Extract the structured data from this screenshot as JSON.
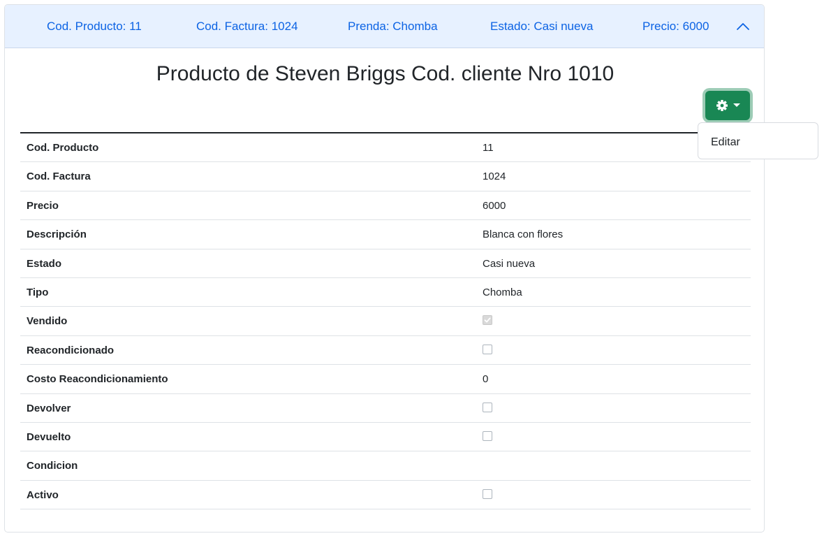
{
  "header": {
    "cod_producto": "Cod. Producto: 11",
    "cod_factura": "Cod. Factura: 1024",
    "prenda": "Prenda: Chomba",
    "estado": "Estado: Casi nueva",
    "precio": "Precio: 6000",
    "toggle_icon": "chevron-up-icon"
  },
  "title": "Producto de Steven Briggs Cod. cliente Nro 1010",
  "actions": {
    "button_icon": "gear-icon",
    "button_color": "#198754",
    "menu": [
      "Editar"
    ]
  },
  "fields": [
    {
      "label": "Cod. Producto",
      "value": "11"
    },
    {
      "label": "Cod. Factura",
      "value": "1024"
    },
    {
      "label": "Precio",
      "value": "6000"
    },
    {
      "label": "Descripción",
      "value": "Blanca con flores"
    },
    {
      "label": "Estado",
      "value": "Casi nueva"
    },
    {
      "label": "Tipo",
      "value": "Chomba"
    },
    {
      "label": "Vendido",
      "checked": true,
      "disabled": true
    },
    {
      "label": "Reacondicionado",
      "checked": false
    },
    {
      "label": "Costo Reacondicionamiento",
      "value": "0"
    },
    {
      "label": "Devolver",
      "checked": false
    },
    {
      "label": "Devuelto",
      "checked": false
    },
    {
      "label": "Condicion",
      "value": ""
    },
    {
      "label": "Activo",
      "checked": false
    }
  ]
}
